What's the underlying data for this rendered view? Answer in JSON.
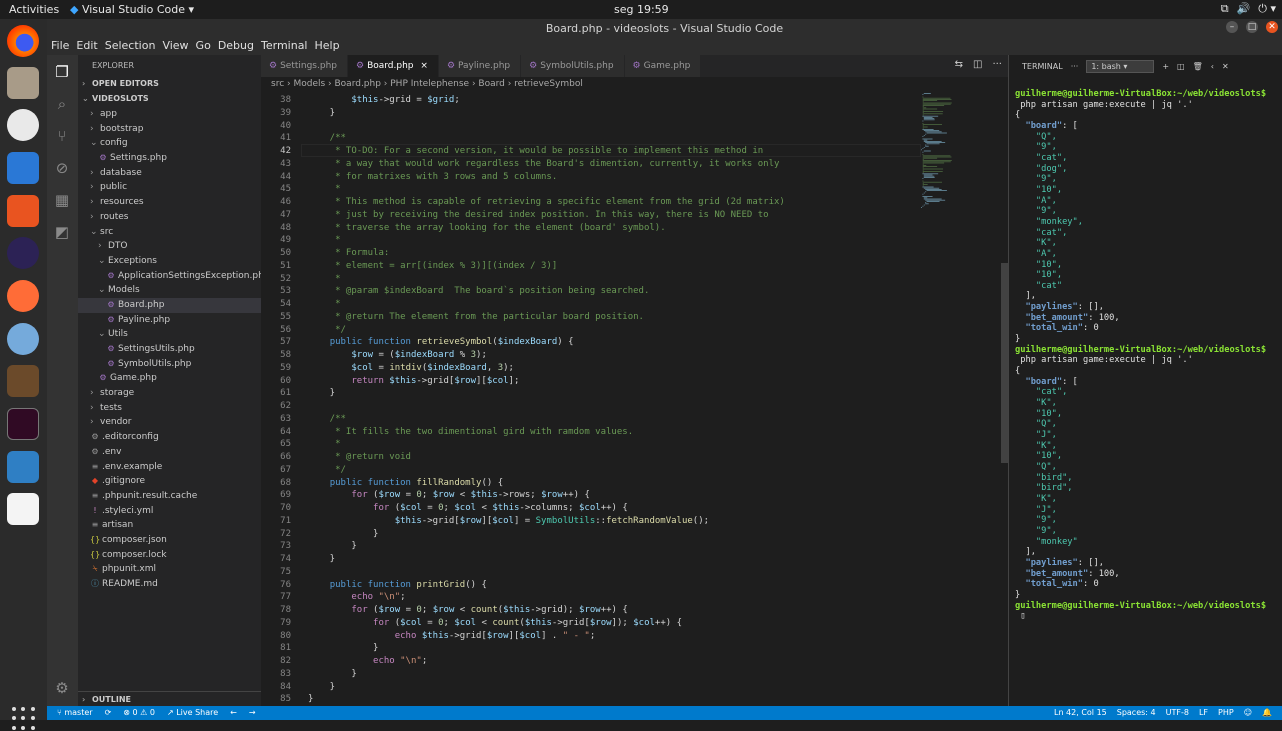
{
  "topbar": {
    "activities": "Activities",
    "app": "Visual Studio Code ▾",
    "clock": "seg 19:59"
  },
  "window": {
    "title": "Board.php - videoslots - Visual Studio Code"
  },
  "menu": [
    "File",
    "Edit",
    "Selection",
    "View",
    "Go",
    "Debug",
    "Terminal",
    "Help"
  ],
  "explorer": {
    "title": "EXPLORER",
    "open_editors": "OPEN EDITORS",
    "project": "VIDEOSLOTS",
    "outline": "OUTLINE"
  },
  "tree": [
    {
      "label": "app",
      "indent": 1,
      "type": "folder",
      "open": false
    },
    {
      "label": "bootstrap",
      "indent": 1,
      "type": "folder",
      "open": false
    },
    {
      "label": "config",
      "indent": 1,
      "type": "folder",
      "open": true
    },
    {
      "label": "Settings.php",
      "indent": 2,
      "type": "php"
    },
    {
      "label": "database",
      "indent": 1,
      "type": "folder",
      "open": false
    },
    {
      "label": "public",
      "indent": 1,
      "type": "folder",
      "open": false
    },
    {
      "label": "resources",
      "indent": 1,
      "type": "folder",
      "open": false
    },
    {
      "label": "routes",
      "indent": 1,
      "type": "folder",
      "open": false
    },
    {
      "label": "src",
      "indent": 1,
      "type": "folder",
      "open": true
    },
    {
      "label": "DTO",
      "indent": 2,
      "type": "folder",
      "open": false
    },
    {
      "label": "Exceptions",
      "indent": 2,
      "type": "folder",
      "open": true
    },
    {
      "label": "ApplicationSettingsException.php",
      "indent": 3,
      "type": "php"
    },
    {
      "label": "Models",
      "indent": 2,
      "type": "folder",
      "open": true
    },
    {
      "label": "Board.php",
      "indent": 3,
      "type": "php",
      "selected": true
    },
    {
      "label": "Payline.php",
      "indent": 3,
      "type": "php"
    },
    {
      "label": "Utils",
      "indent": 2,
      "type": "folder",
      "open": true
    },
    {
      "label": "SettingsUtils.php",
      "indent": 3,
      "type": "php"
    },
    {
      "label": "SymbolUtils.php",
      "indent": 3,
      "type": "php"
    },
    {
      "label": "Game.php",
      "indent": 2,
      "type": "php"
    },
    {
      "label": "storage",
      "indent": 1,
      "type": "folder",
      "open": false
    },
    {
      "label": "tests",
      "indent": 1,
      "type": "folder",
      "open": false
    },
    {
      "label": "vendor",
      "indent": 1,
      "type": "folder",
      "open": false
    },
    {
      "label": ".editorconfig",
      "indent": 1,
      "type": "gear"
    },
    {
      "label": ".env",
      "indent": 1,
      "type": "gear"
    },
    {
      "label": ".env.example",
      "indent": 1,
      "type": "text"
    },
    {
      "label": ".gitignore",
      "indent": 1,
      "type": "git"
    },
    {
      "label": ".phpunit.result.cache",
      "indent": 1,
      "type": "text"
    },
    {
      "label": ".styleci.yml",
      "indent": 1,
      "type": "yml"
    },
    {
      "label": "artisan",
      "indent": 1,
      "type": "text"
    },
    {
      "label": "composer.json",
      "indent": 1,
      "type": "json"
    },
    {
      "label": "composer.lock",
      "indent": 1,
      "type": "json"
    },
    {
      "label": "phpunit.xml",
      "indent": 1,
      "type": "xml"
    },
    {
      "label": "README.md",
      "indent": 1,
      "type": "md"
    }
  ],
  "tabs": [
    {
      "label": "Settings.php",
      "active": false
    },
    {
      "label": "Board.php",
      "active": true
    },
    {
      "label": "Payline.php",
      "active": false
    },
    {
      "label": "SymbolUtils.php",
      "active": false
    },
    {
      "label": "Game.php",
      "active": false
    }
  ],
  "breadcrumb": "src › Models › Board.php › PHP Intelephense › Board › retrieveSymbol",
  "editor": {
    "first_line": 38,
    "current_line": 42,
    "lines": [
      "        $this->grid = $grid;",
      "    }",
      "",
      "    /**",
      "     * TO-DO: For a second version, it would be possible to implement this method in",
      "     * a way that would work regardless the Board's dimention, currently, it works only",
      "     * for matrixes with 3 rows and 5 columns.",
      "     *",
      "     * This method is capable of retrieving a specific element from the grid (2d matrix)",
      "     * just by receiving the desired index position. In this way, there is NO NEED to",
      "     * traverse the array looking for the element (board' symbol).",
      "     *",
      "     * Formula:",
      "     * element = arr[(index % 3)][(index / 3)]",
      "     *",
      "     * @param $indexBoard  The board`s position being searched.",
      "     *",
      "     * @return The element from the particular board position.",
      "     */",
      "    public function retrieveSymbol($indexBoard) {",
      "        $row = ($indexBoard % 3);",
      "        $col = intdiv($indexBoard, 3);",
      "        return $this->grid[$row][$col];",
      "    }",
      "",
      "    /**",
      "     * It fills the two dimentional gird with ramdom values.",
      "     *",
      "     * @return void",
      "     */",
      "    public function fillRandomly() {",
      "        for ($row = 0; $row < $this->rows; $row++) {",
      "            for ($col = 0; $col < $this->columns; $col++) {",
      "                $this->grid[$row][$col] = SymbolUtils::fetchRandomValue();",
      "            }",
      "        }",
      "    }",
      "",
      "    public function printGrid() {",
      "        echo \"\\n\";",
      "        for ($row = 0; $row < count($this->grid); $row++) {",
      "            for ($col = 0; $col < count($this->grid[$row]); $col++) {",
      "                echo $this->grid[$row][$col] . \" - \";",
      "            }",
      "            echo \"\\n\";",
      "        }",
      "    }",
      "}"
    ]
  },
  "terminal": {
    "tab": "TERMINAL",
    "shell": "1: bash",
    "lines": [
      "guilherme@guilherme-VirtualBox:~/web/videoslots$",
      " php artisan game:execute | jq '.'",
      "{",
      "  \"board\": [",
      "    \"Q\",",
      "    \"9\",",
      "    \"cat\",",
      "    \"dog\",",
      "    \"9\",",
      "    \"10\",",
      "    \"A\",",
      "    \"9\",",
      "    \"monkey\",",
      "    \"cat\",",
      "    \"K\",",
      "    \"A\",",
      "    \"10\",",
      "    \"10\",",
      "    \"cat\"",
      "  ],",
      "  \"paylines\": [],",
      "  \"bet_amount\": 100,",
      "  \"total_win\": 0",
      "}",
      "guilherme@guilherme-VirtualBox:~/web/videoslots$",
      " php artisan game:execute | jq '.'",
      "{",
      "  \"board\": [",
      "    \"cat\",",
      "    \"K\",",
      "    \"10\",",
      "    \"Q\",",
      "    \"J\",",
      "    \"K\",",
      "    \"10\",",
      "    \"Q\",",
      "    \"bird\",",
      "    \"bird\",",
      "    \"K\",",
      "    \"J\",",
      "    \"9\",",
      "    \"9\",",
      "    \"monkey\"",
      "  ],",
      "  \"paylines\": [],",
      "  \"bet_amount\": 100,",
      "  \"total_win\": 0",
      "}",
      "guilherme@guilherme-VirtualBox:~/web/videoslots$",
      " ▯"
    ]
  },
  "status": {
    "branch": "master",
    "problems": "⊗ 0 ⚠ 0",
    "liveshare": "Live Share",
    "position": "Ln 42, Col 15",
    "spaces": "Spaces: 4",
    "encoding": "UTF-8",
    "eol": "LF",
    "language": "PHP"
  }
}
